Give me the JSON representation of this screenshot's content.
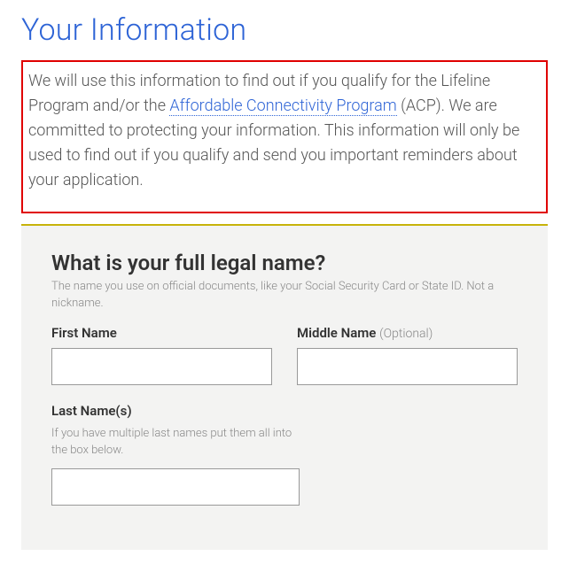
{
  "header": {
    "title": "Your Information"
  },
  "intro": {
    "pre": "We will use this information to find out if you qualify for the Lifeline Program and/or the ",
    "link": "Affordable Connectivity Program",
    "post": " (ACP). We are committed to protecting your information. This information will only be used to find out if you qualify and send you important reminders about your application."
  },
  "form": {
    "question": "What is your full legal name?",
    "question_help": "The name you use on official documents, like your Social Security Card or State ID. Not a nickname.",
    "first_name": {
      "label": "First Name",
      "value": ""
    },
    "middle_name": {
      "label": "Middle Name",
      "optional": "(Optional)",
      "value": ""
    },
    "last_name": {
      "label": "Last Name(s)",
      "help": "If you have multiple last names put them all into the box below.",
      "value": ""
    }
  }
}
